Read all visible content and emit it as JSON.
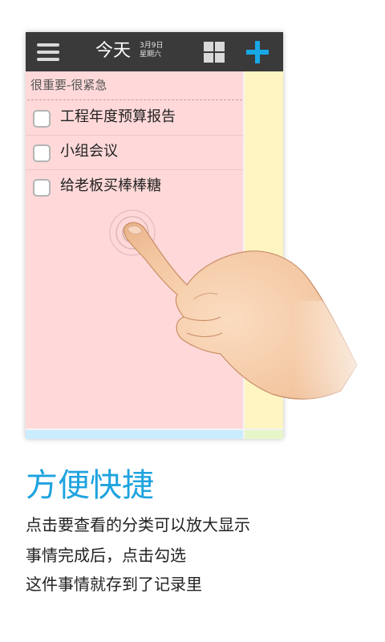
{
  "app": {
    "title": "今天",
    "date_line1": "3月9日",
    "date_line2": "星期六"
  },
  "icons": {
    "menu": "hamburger-icon",
    "grid": "grid-icon",
    "add": "plus-icon"
  },
  "colors": {
    "topbar": "#3a3a3a",
    "accent": "#19a8e6",
    "quad_pink": "#ffd9d9",
    "quad_yellow": "#fff5c2",
    "quad_blue": "#c9ecff",
    "quad_green": "#e7f6c9"
  },
  "quadrant": {
    "heading": "很重要-很紧急",
    "tasks": [
      {
        "label": "工程年度预算报告",
        "checked": false
      },
      {
        "label": "小组会议",
        "checked": false
      },
      {
        "label": "给老板买棒棒糖",
        "checked": false
      }
    ]
  },
  "promo": {
    "headline": "方便快捷",
    "lines": [
      "点击要查看的分类可以放大显示",
      "事情完成后，点击勾选",
      "这件事情就存到了记录里"
    ]
  }
}
